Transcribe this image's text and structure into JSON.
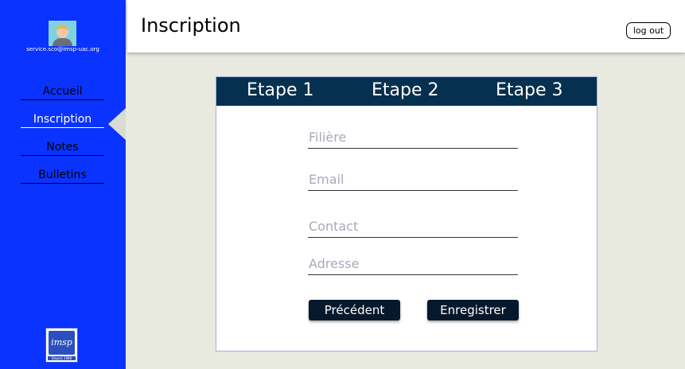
{
  "sidebar": {
    "email": "service.sco@imsp-uac.org",
    "items": [
      {
        "label": "Accueil"
      },
      {
        "label": "Inscription"
      },
      {
        "label": "Notes"
      },
      {
        "label": "Bulletins"
      }
    ],
    "active_index": 1,
    "logo_text": "imsp",
    "logo_tagline": "Depuis 1988"
  },
  "header": {
    "title": "Inscription",
    "logout_label": "log out"
  },
  "steps": [
    {
      "label": "Etape 1"
    },
    {
      "label": "Etape 2"
    },
    {
      "label": "Etape 3"
    }
  ],
  "form": {
    "filiere": {
      "placeholder": "Filière",
      "value": ""
    },
    "email": {
      "placeholder": "Email",
      "value": ""
    },
    "contact": {
      "placeholder": "Contact",
      "value": ""
    },
    "adresse": {
      "placeholder": "Adresse",
      "value": ""
    },
    "prev_label": "Précédent",
    "save_label": "Enregistrer"
  },
  "colors": {
    "sidebar_bg": "#0b33ff",
    "steps_bg": "#06304f",
    "button_bg": "#06182b",
    "page_bg": "#e8eae0"
  }
}
